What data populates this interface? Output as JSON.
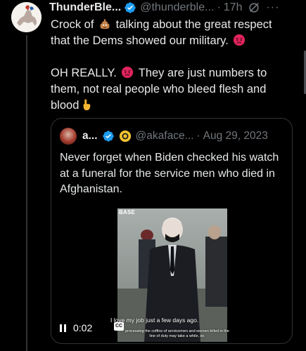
{
  "tweet": {
    "display_name": "ThunderBle...",
    "handle": "@thunderble...",
    "separator": "·",
    "time": "17h",
    "more": "···",
    "line1_a": "Crock of",
    "line1_b": "talking about the great respect that the Dems showed our military.",
    "line2_a": "OH REALLY.",
    "line2_b": "They are just numbers to them, not real people who bleed flesh and blood"
  },
  "quote": {
    "display_name": "a...",
    "handle": "@akaface...",
    "separator": "·",
    "date": "Aug 29, 2023",
    "text": "Never forget when Biden checked his watch at a funeral for the service men who died in Afghanistan.",
    "video": {
      "watermark": "BASE",
      "caption_main": "I love my job just a few days ago.",
      "caption_sub": "processing the coffins of servicemen and women killed in the line of duty may take a while, sir.",
      "time": "0:02",
      "cc": "CC"
    }
  },
  "colors": {
    "background": "#000000",
    "text": "#e7e9ea",
    "secondary": "#71767b",
    "border": "#2f3336",
    "verified": "#1d9bf0"
  },
  "icons": [
    "verified-badge-icon",
    "grok-icon",
    "more-icon",
    "poop-emoji-icon",
    "angry-emoji-icon",
    "pointing-down-emoji-icon",
    "gold-badge-icon",
    "pause-icon",
    "cc-icon"
  ]
}
